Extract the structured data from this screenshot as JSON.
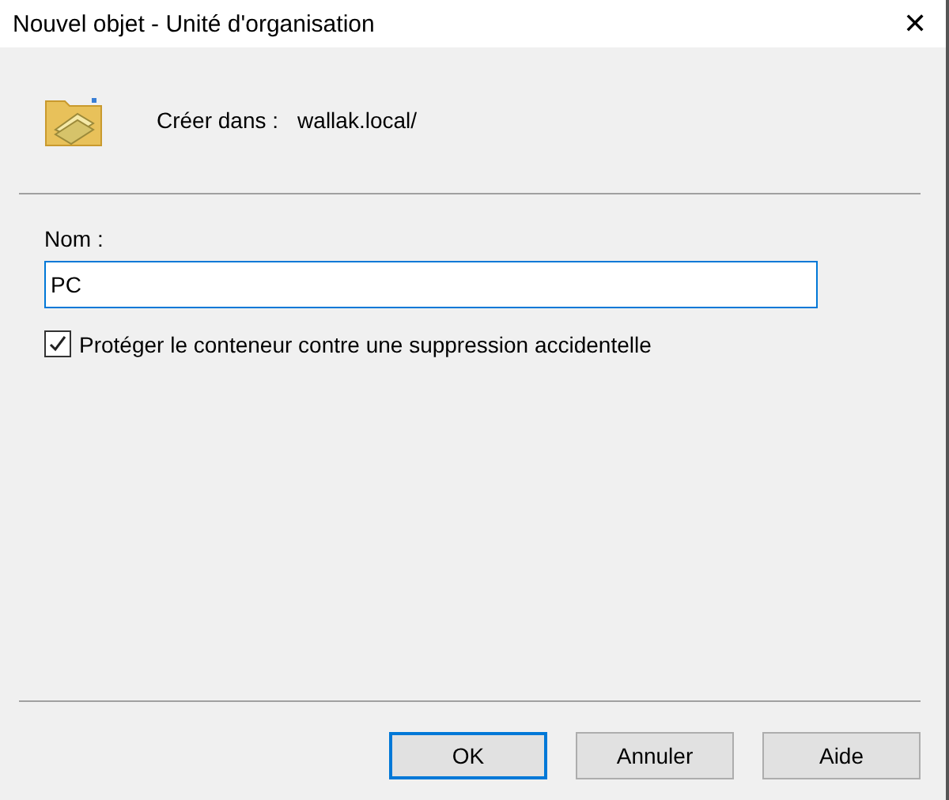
{
  "window": {
    "title": "Nouvel objet - Unité d'organisation",
    "close": "✕"
  },
  "location": {
    "label": "Créer dans :",
    "value": "wallak.local/"
  },
  "name_field": {
    "label": "Nom :",
    "value": "PC",
    "focused": true
  },
  "protect": {
    "label": "Protéger le conteneur contre une suppression accidentelle",
    "checked": true
  },
  "buttons": [
    {
      "label": "OK",
      "default": true
    },
    {
      "label": "Annuler",
      "default": false
    },
    {
      "label": "Aide",
      "default": false
    }
  ]
}
